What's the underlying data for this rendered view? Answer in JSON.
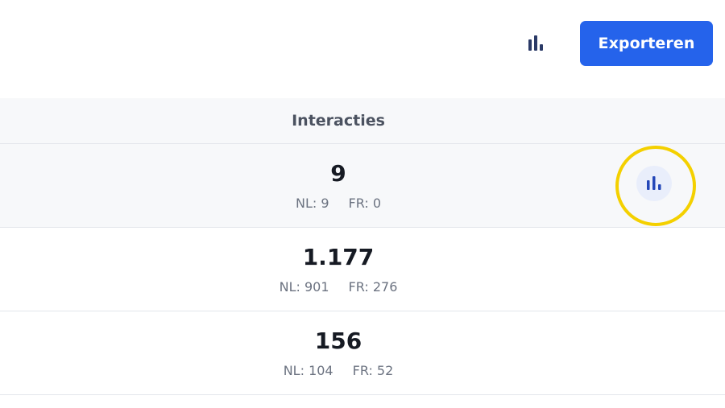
{
  "toolbar": {
    "chart_toggle_icon": "bar-chart-icon",
    "export_label": "Exporteren"
  },
  "table": {
    "column_header": "Interacties",
    "rows": [
      {
        "total": "9",
        "nl": "NL: 9",
        "fr": "FR: 0",
        "has_chart_button": true
      },
      {
        "total": "1.177",
        "nl": "NL: 901",
        "fr": "FR: 276",
        "has_chart_button": false
      },
      {
        "total": "156",
        "nl": "NL: 104",
        "fr": "FR: 52",
        "has_chart_button": false
      }
    ]
  },
  "colors": {
    "accent": "#2563eb",
    "icon": "#2b3a67",
    "row_icon": "#2447b8",
    "focus_ring": "#f4d000",
    "header_bg": "#f7f8fa"
  }
}
